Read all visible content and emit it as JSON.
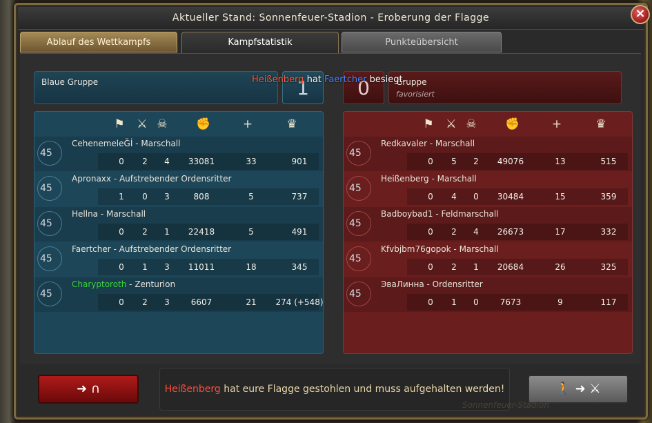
{
  "window": {
    "title": "Aktueller Stand: Sonnenfeuer-Stadion - Eroberung der Flagge"
  },
  "tabs": [
    {
      "label": "Ablauf des Wettkampfs"
    },
    {
      "label": "Kampfstatistik"
    },
    {
      "label": "Punkteübersicht"
    }
  ],
  "kill_message": {
    "killer": "Heißenberg",
    "verb": "hat",
    "victim": "Faertcher",
    "suffix": "besiegt."
  },
  "teams": {
    "blue": {
      "name": "Blaue Gruppe",
      "score": "1"
    },
    "red": {
      "name": "Gruppe",
      "score": "0",
      "status": "favorisiert"
    }
  },
  "column_icons": [
    "flag-icon",
    "crossed-swords-icon",
    "skull-icon",
    "fist-icon",
    "plus-icon",
    "crown-icon"
  ],
  "blue_players": [
    {
      "level": "45",
      "name": "CehenemeleĞİ",
      "rank": "Marschall",
      "stats": [
        "0",
        "2",
        "4",
        "33081",
        "33",
        "901"
      ]
    },
    {
      "level": "45",
      "name": "Apronaxx",
      "rank": "Aufstrebender Ordensritter",
      "stats": [
        "1",
        "0",
        "3",
        "808",
        "5",
        "737"
      ]
    },
    {
      "level": "45",
      "name": "Hellna",
      "rank": "Marschall",
      "stats": [
        "0",
        "2",
        "1",
        "22418",
        "5",
        "491"
      ]
    },
    {
      "level": "45",
      "name": "Faertcher",
      "rank": "Aufstrebender Ordensritter",
      "stats": [
        "0",
        "1",
        "3",
        "11011",
        "18",
        "345"
      ]
    },
    {
      "level": "45",
      "name": "Charyptoroth",
      "rank": "Zenturion",
      "stats": [
        "0",
        "2",
        "3",
        "6607",
        "21",
        "274 (+548)"
      ]
    }
  ],
  "red_players": [
    {
      "level": "45",
      "name": "Redkavaler",
      "rank": "Marschall",
      "stats": [
        "0",
        "5",
        "2",
        "49076",
        "13",
        "515"
      ]
    },
    {
      "level": "45",
      "name": "Heißenberg",
      "rank": "Marschall",
      "stats": [
        "0",
        "4",
        "0",
        "30484",
        "15",
        "359"
      ]
    },
    {
      "level": "45",
      "name": "Badboybad1",
      "rank": "Feldmarschall",
      "stats": [
        "0",
        "2",
        "4",
        "26673",
        "17",
        "332"
      ]
    },
    {
      "level": "45",
      "name": "Kfvbjbm76gopok",
      "rank": "Marschall",
      "stats": [
        "0",
        "2",
        "1",
        "20684",
        "26",
        "325"
      ]
    },
    {
      "level": "45",
      "name": "ЭваЛинна",
      "rank": "Ordensritter",
      "stats": [
        "0",
        "1",
        "0",
        "7673",
        "9",
        "117"
      ]
    }
  ],
  "bottom": {
    "leave_icon": "arrow-to-gate-icon",
    "message_name": "Heißenberg",
    "message_text": "hat eure Flagge gestohlen und muss aufgehalten werden!",
    "switch_icon": "walk-to-fight-icon"
  },
  "watermark": "Sonnenfeuer-Stadion",
  "colors": {
    "blue_team": "#1d4658",
    "red_team": "#6a1e1e",
    "accent_gold": "#7c6a45",
    "highlight_green": "#39d439"
  }
}
